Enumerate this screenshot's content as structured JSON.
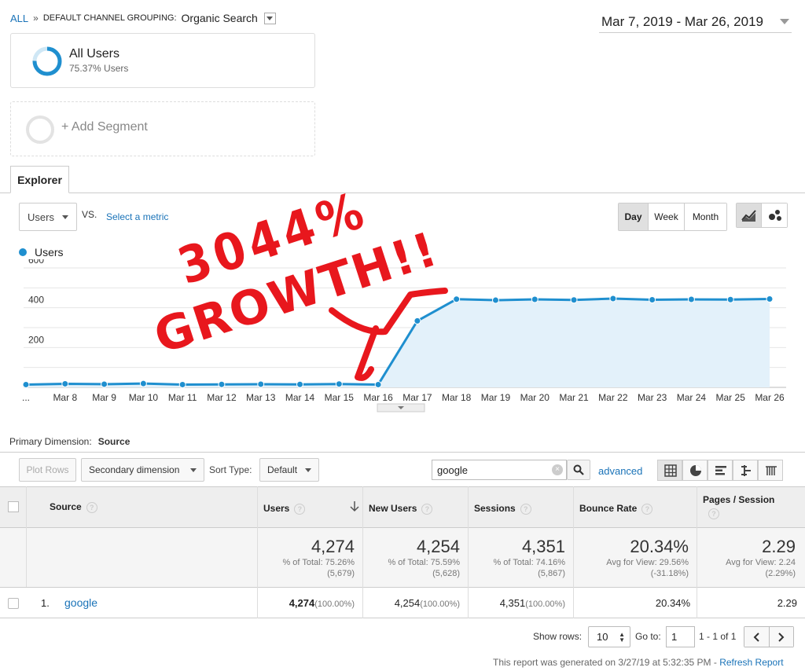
{
  "breadcrumb": {
    "all": "ALL",
    "sep": "»",
    "grouping_label": "DEFAULT CHANNEL GROUPING:",
    "grouping_value": "Organic Search"
  },
  "date_range": "Mar 7, 2019 - Mar 26, 2019",
  "segments": {
    "all_users_title": "All Users",
    "all_users_sub": "75.37% Users",
    "add_segment": "+ Add Segment"
  },
  "tabs": {
    "explorer": "Explorer"
  },
  "metric": {
    "selected": "Users",
    "vs": "VS.",
    "select_metric": "Select a metric"
  },
  "granularity": {
    "day": "Day",
    "week": "Week",
    "month": "Month"
  },
  "legend": {
    "users": "Users"
  },
  "annotation": {
    "line1": "3044%",
    "line2": "GROWTH!!"
  },
  "chart_data": {
    "type": "area",
    "x": [
      "Mar 7",
      "Mar 8",
      "Mar 9",
      "Mar 10",
      "Mar 11",
      "Mar 12",
      "Mar 13",
      "Mar 14",
      "Mar 15",
      "Mar 16",
      "Mar 17",
      "Mar 18",
      "Mar 19",
      "Mar 20",
      "Mar 21",
      "Mar 22",
      "Mar 23",
      "Mar 24",
      "Mar 25",
      "Mar 26"
    ],
    "xtick_labels": [
      "...",
      "Mar 8",
      "Mar 9",
      "Mar 10",
      "Mar 11",
      "Mar 12",
      "Mar 13",
      "Mar 14",
      "Mar 15",
      "Mar 16",
      "Mar 17",
      "Mar 18",
      "Mar 19",
      "Mar 20",
      "Mar 21",
      "Mar 22",
      "Mar 23",
      "Mar 24",
      "Mar 25",
      "Mar 26"
    ],
    "series": [
      {
        "name": "Users",
        "values": [
          14,
          18,
          16,
          19,
          14,
          15,
          16,
          15,
          17,
          14,
          334,
          443,
          438,
          442,
          439,
          446,
          440,
          442,
          441,
          444
        ]
      }
    ],
    "yticks": [
      "600",
      "400",
      "200"
    ],
    "ylim": [
      0,
      600
    ],
    "color": "#1f8fcf",
    "fill": "#e3f1fa",
    "grid": true
  },
  "primary_dimension": {
    "label": "Primary Dimension:",
    "value": "Source"
  },
  "toolbar": {
    "plot_rows": "Plot Rows",
    "secondary_dimension": "Secondary dimension",
    "sort_type_label": "Sort Type:",
    "sort_type_value": "Default",
    "search_value": "google",
    "advanced": "advanced"
  },
  "table": {
    "headers": {
      "source": "Source",
      "users": "Users",
      "new_users": "New Users",
      "sessions": "Sessions",
      "bounce_rate": "Bounce Rate",
      "pages_session": "Pages / Session"
    },
    "totals": {
      "users": {
        "value": "4,274",
        "l1": "% of Total: 75.26%",
        "l2": "(5,679)"
      },
      "new_users": {
        "value": "4,254",
        "l1": "% of Total: 75.59%",
        "l2": "(5,628)"
      },
      "sessions": {
        "value": "4,351",
        "l1": "% of Total: 74.16%",
        "l2": "(5,867)"
      },
      "bounce_rate": {
        "value": "20.34%",
        "l1": "Avg for View: 29.56%",
        "l2": "(-31.18%)"
      },
      "pages_session": {
        "value": "2.29",
        "l1": "Avg for View: 2.24",
        "l2": "(2.29%)"
      }
    },
    "rows": [
      {
        "index": "1.",
        "source": "google",
        "users": "4,274",
        "users_pct": "(100.00%)",
        "new_users": "4,254",
        "new_users_pct": "(100.00%)",
        "sessions": "4,351",
        "sessions_pct": "(100.00%)",
        "bounce_rate": "20.34%",
        "pages_session": "2.29"
      }
    ]
  },
  "pagination": {
    "show_rows_label": "Show rows:",
    "show_rows_value": "10",
    "goto_label": "Go to:",
    "goto_value": "1",
    "range": "1 - 1 of 1"
  },
  "footer": {
    "generated": "This report was generated on 3/27/19 at 5:32:35 PM -",
    "refresh": "Refresh Report"
  }
}
